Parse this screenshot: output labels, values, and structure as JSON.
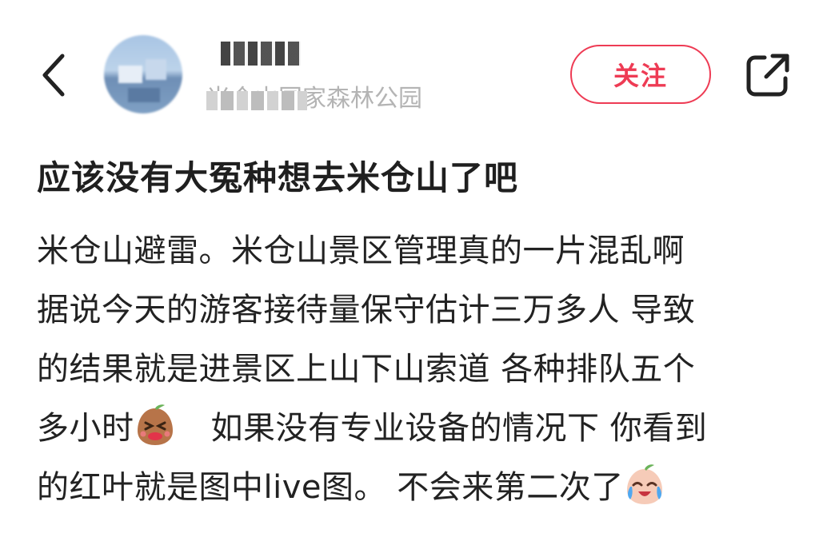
{
  "header": {
    "username": "青猫由",
    "location": "米仓山国家森林公园",
    "follow_label": "关注"
  },
  "post": {
    "title": "应该没有大冤种想去米仓山了吧",
    "lines": [
      "米仓山避雷。米仓山景区管理真的一片混乱啊",
      "据说今天的游客接待量保守估计三万多人 导致",
      "的结果就是进景区上山下山索道 各种排队五个",
      "多小时",
      "如果没有专业设备的情况下 你看到",
      "的红叶就是图中live图。 不会来第二次了"
    ]
  },
  "icons": {
    "back": "chevron-left-icon",
    "share": "share-icon",
    "emoji_1": "grimace-emoji-icon",
    "emoji_2": "crying-laughing-emoji-icon"
  },
  "colors": {
    "accent": "#ee3b54",
    "text": "#222222",
    "muted": "#b4b4b4"
  }
}
